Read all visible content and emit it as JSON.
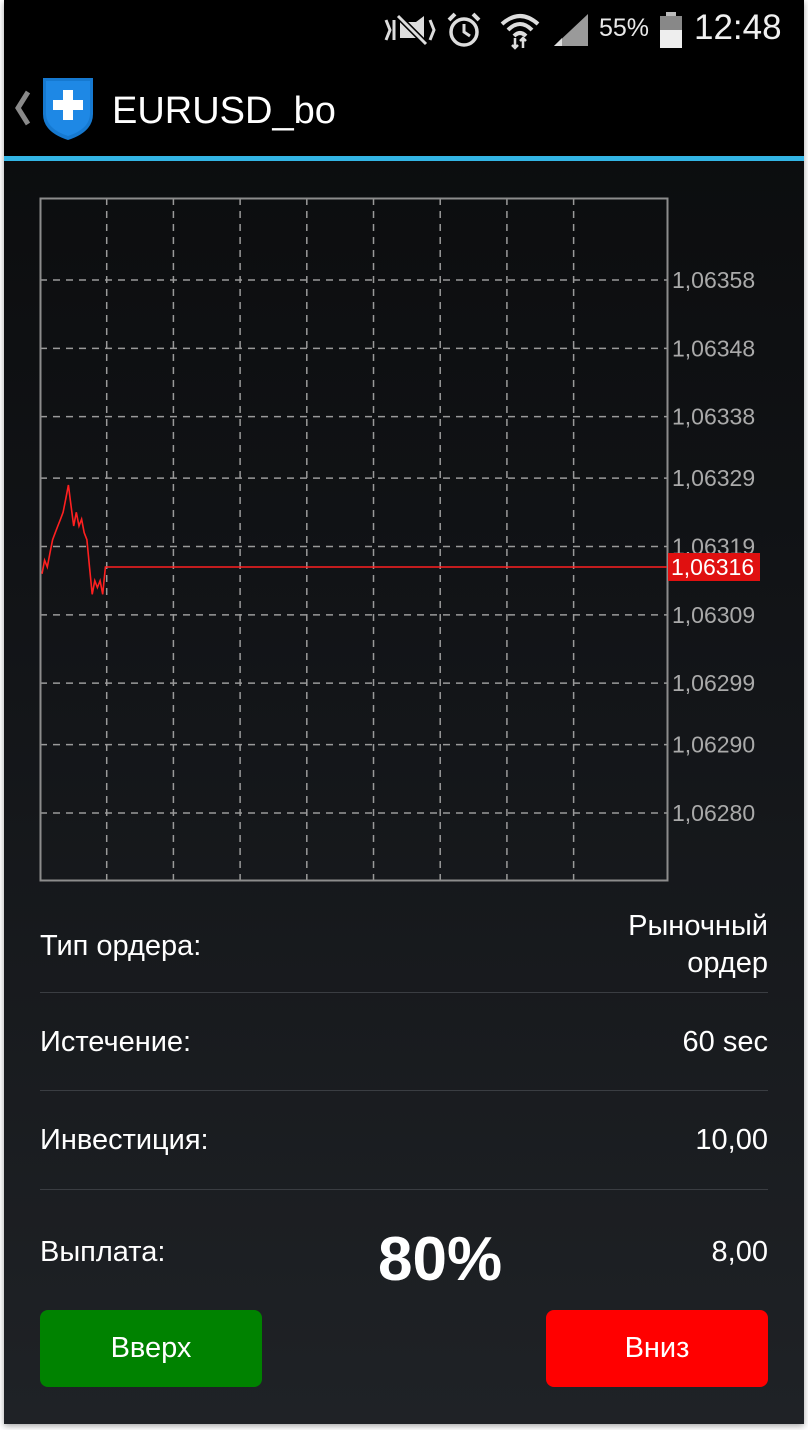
{
  "status_bar": {
    "battery_percent": "55%",
    "time": "12:48",
    "icons": [
      "mute-vibrate-icon",
      "alarm-icon",
      "wifi-icon",
      "signal-icon",
      "battery-icon"
    ]
  },
  "header": {
    "title": "EURUSD_bo",
    "icons": [
      "back-chevron-icon",
      "app-shield-logo"
    ]
  },
  "colors": {
    "accent": "#33b5e5",
    "price_line": "#ff2020",
    "up_button": "#008200",
    "down_button": "#ff0000"
  },
  "chart_data": {
    "type": "line",
    "y_tick_labels": [
      "1,06358",
      "1,06348",
      "1,06338",
      "1,06329",
      "1,06319",
      "1,06309",
      "1,06299",
      "1,06290",
      "1,06280"
    ],
    "y_tick_values": [
      1.06358,
      1.06348,
      1.06338,
      1.06329,
      1.06319,
      1.06309,
      1.06299,
      1.0629,
      1.0628
    ],
    "current_price_label": "1,06316",
    "current_price": 1.06316,
    "grid": true,
    "series": [
      {
        "values": [
          1.06315,
          1.06317,
          1.06316,
          1.06318,
          1.0632,
          1.06321,
          1.06322,
          1.06323,
          1.06324,
          1.06326,
          1.06328,
          1.06325,
          1.06322,
          1.06324,
          1.06322,
          1.06323,
          1.06321,
          1.0632,
          1.06316,
          1.06312,
          1.06314,
          1.06313,
          1.06314,
          1.06312,
          1.06316,
          1.06316
        ]
      }
    ]
  },
  "order": {
    "type_label": "Тип ордера:",
    "type_value_line1": "Рыночный",
    "type_value_line2": "ордер",
    "expiry_label": "Истечение:",
    "expiry_value": "60 sec",
    "investment_label": "Инвестиция:",
    "investment_value": "10,00",
    "payout_label": "Выплата:",
    "payout_percent": "80%",
    "payout_value": "8,00"
  },
  "buttons": {
    "up_label": "Вверх",
    "down_label": "Вниз"
  }
}
